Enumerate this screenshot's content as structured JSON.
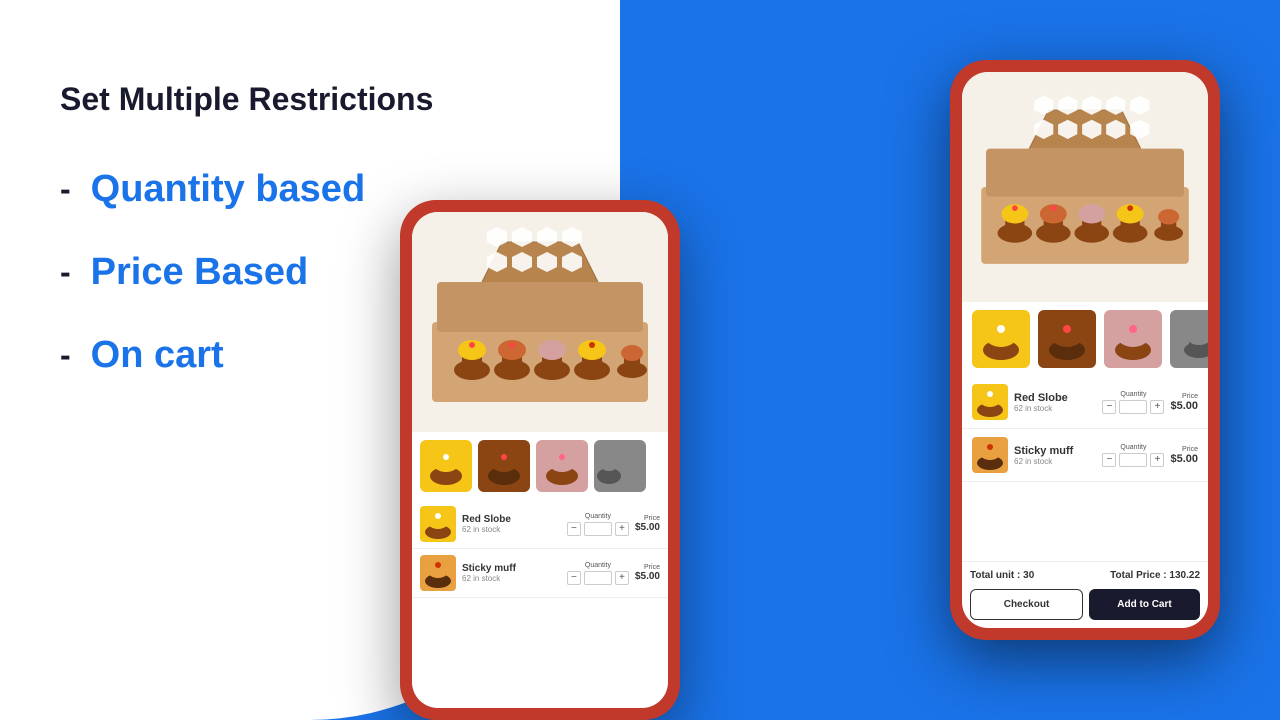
{
  "page": {
    "background": "#1a73e8"
  },
  "left": {
    "title": "Set Multiple Restrictions",
    "items": [
      {
        "dash": "-",
        "label": "Quantity based"
      },
      {
        "dash": "-",
        "label": "Price Based"
      },
      {
        "dash": "-",
        "label": "On cart"
      }
    ]
  },
  "phone_small": {
    "product1": {
      "name": "Red Slobe",
      "stock": "62 in stock",
      "qty_label": "Quantity",
      "price_label": "Price",
      "price": "$5.00"
    },
    "product2": {
      "name": "Sticky muff",
      "stock": "62 in stock",
      "qty_label": "Quantity",
      "price_label": "Price",
      "price": "$5.00"
    }
  },
  "phone_large": {
    "total_unit_label": "Total unit : 30",
    "total_price_label": "Total Price : 130.22",
    "btn_checkout": "Checkout",
    "btn_add_to_cart": "Add to Cart",
    "product1": {
      "name": "Red Slobe",
      "stock": "62 in stock",
      "qty_label": "Quantity",
      "price_label": "Price",
      "price": "$5.00"
    },
    "product2": {
      "name": "Sticky muff",
      "stock": "62 in stock",
      "qty_label": "Quantity",
      "price_label": "Price",
      "price": "$5.00"
    }
  }
}
